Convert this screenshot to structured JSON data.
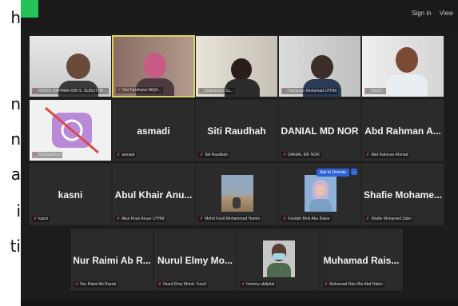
{
  "side_text": [
    "h",
    "n",
    "n",
    "a",
    "i",
    "ti"
  ],
  "topbar": {
    "sign_in": "Sign in",
    "view": "View"
  },
  "tiles": {
    "t1": {
      "label": "ABDUL RAHMAN BIN S. SUNUTHR..."
    },
    "t2": {
      "label": "Nur Farahana NiQA..."
    },
    "t3": {
      "label": "NabilaZain Su..."
    },
    "t4": {
      "label": "Hamizam Mohamad UTHM"
    },
    "t5": {
      "label": "HaniT..."
    },
    "t6": {
      "label": "SitiSulaiman"
    },
    "t7": {
      "name": "asmadi",
      "label": "asmadi"
    },
    "t8": {
      "name": "Siti Raudhah",
      "label": "Siti Raudhah"
    },
    "t9": {
      "name": "DANIAL MD NOR",
      "label": "DANIAL MD NOR"
    },
    "t10": {
      "name": "Abd Rahman A...",
      "label": "Abd Rahman Ahmad"
    },
    "t11": {
      "name": "kasni",
      "label": "kasni"
    },
    "t12": {
      "name": "Abul Khair Anu...",
      "label": "Abul Khair Anuar UTHM"
    },
    "t13": {
      "label": "Mohd Farid Mohammad Hamin"
    },
    "t14": {
      "label": "Faridah Binti Abu Bakar",
      "popup": "Ask to Unmute"
    },
    "t15": {
      "name": "Shafie Mohame...",
      "label": "Shafie Mohamed Zabri"
    },
    "t16": {
      "name": "Nur Raimi Ab R...",
      "label": "Nur Raimi Ab Razak"
    },
    "t17": {
      "name": "Nurul Elmy Mo...",
      "label": "Nurul Elmy Mohd. Yusof"
    },
    "t18": {
      "label": "hemmy abdjalal"
    },
    "t19": {
      "name": "Muhamad Rais...",
      "label": "Muhamad Rais Bin Abd Halim"
    }
  },
  "colors": {
    "background": "#1c1c1c",
    "tile": "#2b2b2b",
    "active_border": "#d7d36a",
    "muted_mic": "#e24a4a",
    "corner": "#27c15a"
  }
}
